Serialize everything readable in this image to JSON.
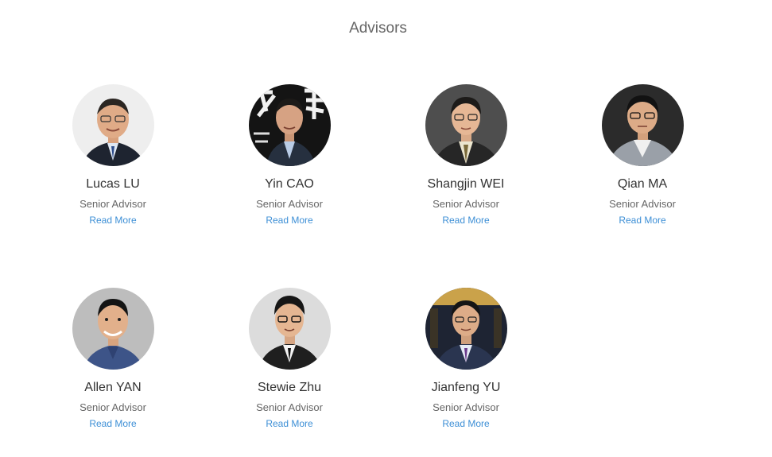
{
  "section": {
    "title": "Advisors"
  },
  "read_more_label": "Read More",
  "advisors": [
    {
      "name": "Lucas LU",
      "role": "Senior Advisor"
    },
    {
      "name": "Yin CAO",
      "role": "Senior Advisor"
    },
    {
      "name": "Shangjin WEI",
      "role": "Senior Advisor"
    },
    {
      "name": "Qian MA",
      "role": "Senior Advisor"
    },
    {
      "name": "Allen YAN",
      "role": "Senior Advisor"
    },
    {
      "name": "Stewie Zhu",
      "role": "Senior Advisor"
    },
    {
      "name": "Jianfeng YU",
      "role": "Senior Advisor"
    }
  ],
  "colors": {
    "title": "#666666",
    "name": "#333333",
    "role": "#666666",
    "link": "#3d8fd6"
  }
}
